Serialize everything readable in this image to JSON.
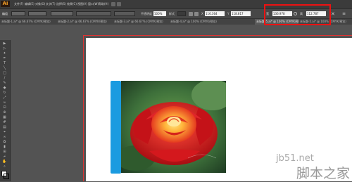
{
  "app": {
    "logo": "Ai"
  },
  "menubar": {
    "items": [
      "文件(F)",
      "编辑(E)",
      "对象(O)",
      "文字(T)",
      "选择(S)",
      "效果(C)",
      "视图(V)",
      "窗口(W)",
      "帮助(H)"
    ]
  },
  "control_bar": {
    "group_label": "编组",
    "opacity_label": "不透明度",
    "opacity_value": "100%",
    "style_label": "样式",
    "x_label": "X",
    "x_value": "116.364",
    "y_label": "Y",
    "y_value": "118.817",
    "w_label": "宽",
    "w_value": "136.978",
    "h_label": "高",
    "h_value": "112.787"
  },
  "tabs": [
    "未标题-1.ai* @ 66.67% (CMYK/预览)",
    "未标题-2.ai* @ 66.67% (CMYK/预览)",
    "未标题-3.ai* @ 66.67% (CMYK/预览)",
    "未标题-4.ai* @ 100% (CMYK/预览)",
    "未标题-5.ai* @ 100% (CMYK/预览)"
  ],
  "watermark": {
    "line1": "jb51.net",
    "line2": "脚本之家"
  },
  "colors": {
    "accent_blue": "#1a9be0",
    "highlight_red": "#e11111"
  },
  "icons": [
    "selection-tool-icon",
    "direct-selection-icon",
    "magic-wand-icon",
    "pen-tool-icon",
    "type-tool-icon",
    "line-tool-icon",
    "rectangle-tool-icon",
    "brush-tool-icon",
    "pencil-tool-icon",
    "eraser-tool-icon",
    "rotate-tool-icon",
    "scale-tool-icon",
    "width-tool-icon",
    "free-transform-icon",
    "shape-builder-icon",
    "perspective-grid-icon",
    "mesh-tool-icon",
    "gradient-tool-icon",
    "eyedropper-tool-icon",
    "blend-tool-icon",
    "symbol-sprayer-icon",
    "column-graph-icon",
    "artboard-tool-icon",
    "slice-tool-icon",
    "hand-tool-icon",
    "zoom-tool-icon"
  ]
}
